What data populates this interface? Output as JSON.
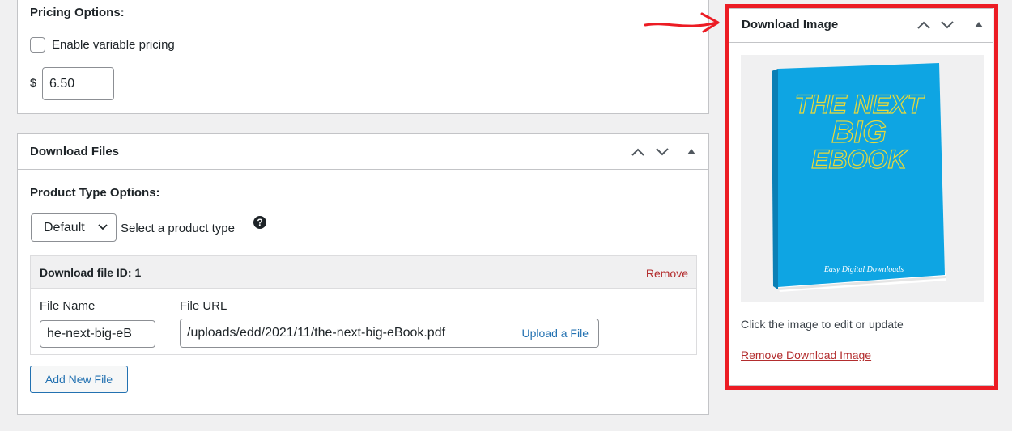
{
  "pricing": {
    "heading": "Pricing Options:",
    "variable_label": "Enable variable pricing",
    "variable_checked": false,
    "currency": "$",
    "price_value": "6.50"
  },
  "files": {
    "title": "Download Files",
    "product_type_heading": "Product Type Options:",
    "product_type_selected": "Default",
    "product_type_hint": "Select a product type",
    "file": {
      "id_label": "Download file ID: 1",
      "remove_label": "Remove",
      "name_label": "File Name",
      "url_label": "File URL",
      "name_value": "he-next-big-eB",
      "url_value": "/uploads/edd/2021/11/the-next-big-eBook.pdf",
      "upload_label": "Upload a File"
    },
    "add_new_label": "Add New File"
  },
  "image_panel": {
    "title": "Download Image",
    "cover": {
      "title_line1": "THE NEXT",
      "title_line2": "BIG",
      "title_line3": "EBOOK",
      "publisher": "Easy Digital Downloads"
    },
    "hint": "Click the image to edit or update",
    "remove_label": "Remove Download Image"
  },
  "colors": {
    "accent": "#2271b1",
    "danger": "#b32d2e",
    "highlight": "#ec1c24",
    "book_blue": "#0ea5e3",
    "book_title": "#e8d93a"
  },
  "icons": [
    "chevron-up-icon",
    "chevron-down-icon",
    "triangle-toggle-icon",
    "help-icon",
    "arrow-annotation-icon"
  ]
}
